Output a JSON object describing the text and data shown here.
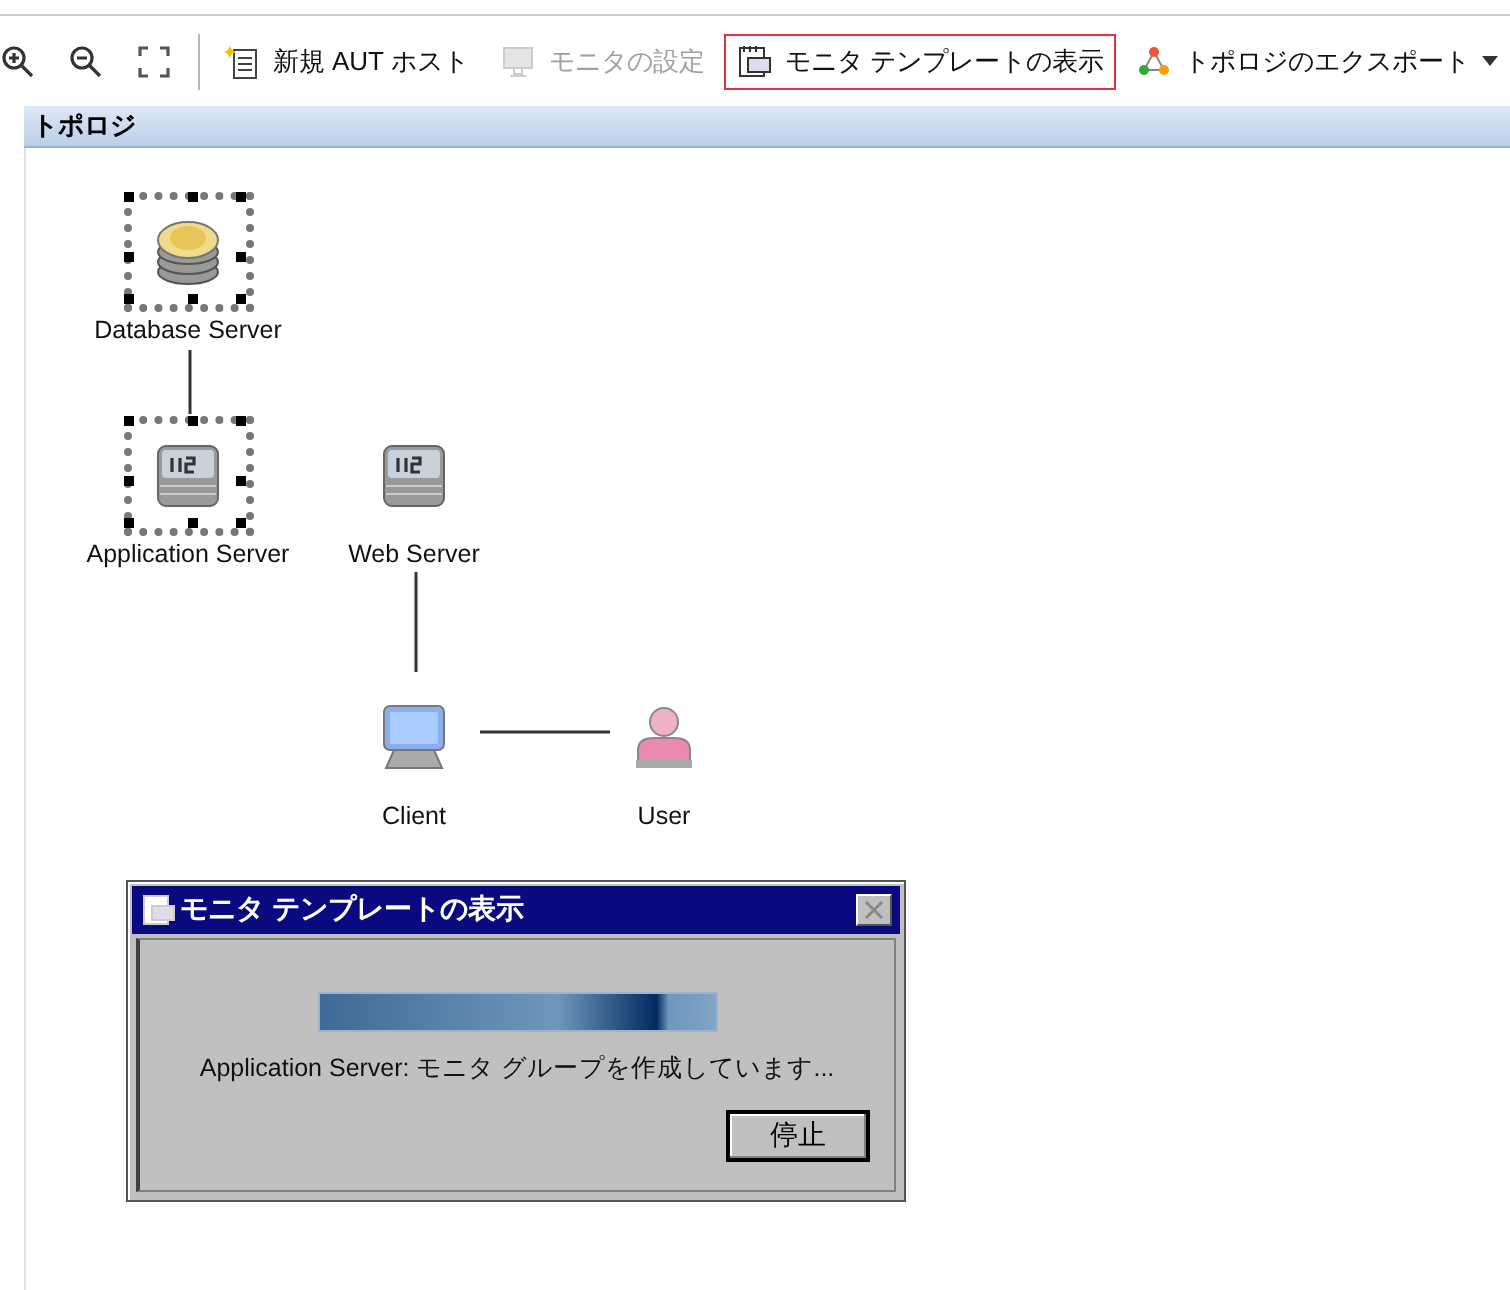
{
  "toolbar": {
    "items": [
      {
        "kind": "zoom-in",
        "highlighted": false,
        "disabled": false
      },
      {
        "kind": "zoom-out",
        "highlighted": false,
        "disabled": false
      },
      {
        "kind": "fit",
        "highlighted": false,
        "disabled": false
      },
      {
        "kind": "separator"
      },
      {
        "kind": "new-host",
        "label": "新規 AUT ホスト",
        "highlighted": false,
        "disabled": false
      },
      {
        "kind": "monitor-settings",
        "label": "モニタの設定",
        "highlighted": false,
        "disabled": true
      },
      {
        "kind": "template",
        "label": "モニタ テンプレートの表示",
        "highlighted": true,
        "disabled": false
      },
      {
        "kind": "export",
        "label": "トポロジのエクスポート",
        "highlighted": false,
        "disabled": false,
        "dropdown": true
      }
    ]
  },
  "panel": {
    "title": "トポロジ"
  },
  "nodes": [
    {
      "label": "Database Server",
      "kind": "database",
      "selected": true
    },
    {
      "label": "Application Server",
      "kind": "server",
      "selected": true
    },
    {
      "label": "Web Server",
      "kind": "server",
      "selected": false
    },
    {
      "label": "Client",
      "kind": "client",
      "selected": false
    },
    {
      "label": "User",
      "kind": "user",
      "selected": false
    }
  ],
  "dialog": {
    "title": "モニタ テンプレートの表示",
    "progress": {
      "level": 1
    },
    "message": "Application Server: モニタ グループを作成しています...",
    "button": "停止"
  }
}
